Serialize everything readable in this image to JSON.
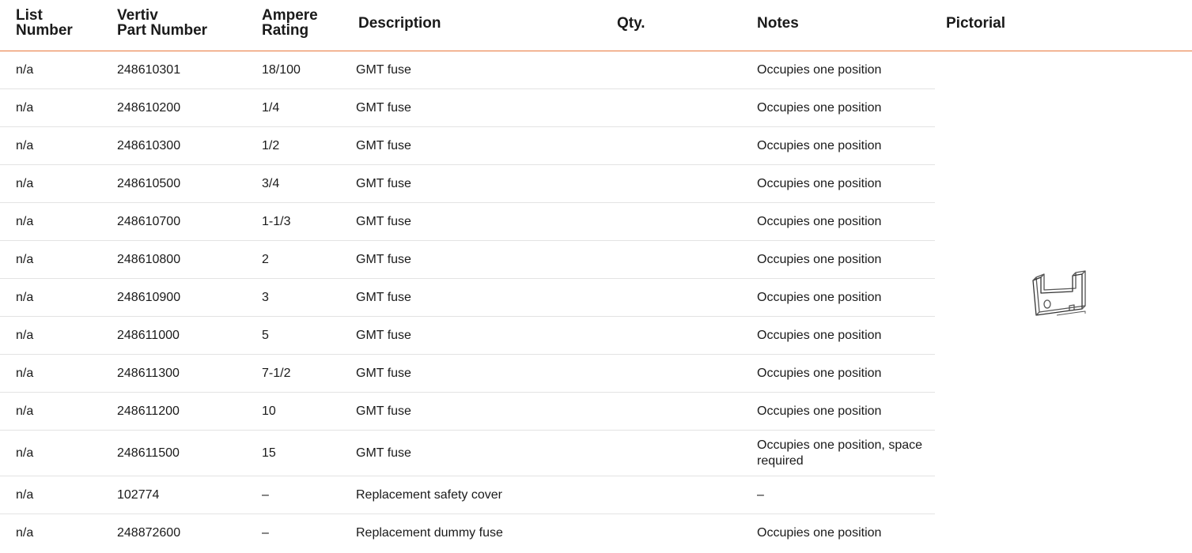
{
  "table": {
    "headers": {
      "list_number": [
        "List",
        "Number"
      ],
      "part_number": [
        "Vertiv",
        "Part Number"
      ],
      "ampere_rating": [
        "Ampere",
        "Rating"
      ],
      "description": "Description",
      "qty": "Qty.",
      "notes": "Notes",
      "pictorial": "Pictorial"
    },
    "rows": [
      {
        "list": "n/a",
        "part": "248610301",
        "amp": "18/100",
        "desc": "GMT fuse",
        "qty": "",
        "notes": "Occupies one position"
      },
      {
        "list": "n/a",
        "part": "248610200",
        "amp": "1/4",
        "desc": "GMT fuse",
        "qty": "",
        "notes": "Occupies one position"
      },
      {
        "list": "n/a",
        "part": "248610300",
        "amp": "1/2",
        "desc": "GMT fuse",
        "qty": "",
        "notes": "Occupies one position"
      },
      {
        "list": "n/a",
        "part": "248610500",
        "amp": "3/4",
        "desc": "GMT fuse",
        "qty": "",
        "notes": "Occupies one position"
      },
      {
        "list": "n/a",
        "part": "248610700",
        "amp": "1-1/3",
        "desc": "GMT fuse",
        "qty": "",
        "notes": "Occupies one position"
      },
      {
        "list": "n/a",
        "part": "248610800",
        "amp": "2",
        "desc": "GMT fuse",
        "qty": "",
        "notes": "Occupies one position"
      },
      {
        "list": "n/a",
        "part": "248610900",
        "amp": "3",
        "desc": "GMT fuse",
        "qty": "",
        "notes": "Occupies one position"
      },
      {
        "list": "n/a",
        "part": "248611000",
        "amp": "5",
        "desc": "GMT fuse",
        "qty": "",
        "notes": "Occupies one position"
      },
      {
        "list": "n/a",
        "part": "248611300",
        "amp": "7-1/2",
        "desc": "GMT fuse",
        "qty": "",
        "notes": "Occupies one position"
      },
      {
        "list": "n/a",
        "part": "248611200",
        "amp": "10",
        "desc": "GMT fuse",
        "qty": "",
        "notes": "Occupies one position"
      },
      {
        "list": "n/a",
        "part": "248611500",
        "amp": "15",
        "desc": "GMT fuse",
        "qty": "",
        "notes": "Occupies one position, space required"
      },
      {
        "list": "n/a",
        "part": "102774",
        "amp": "–",
        "desc": "Replacement safety cover",
        "qty": "",
        "notes": "–"
      },
      {
        "list": "n/a",
        "part": "248872600",
        "amp": "–",
        "desc": "Replacement dummy fuse",
        "qty": "",
        "notes": "Occupies one position"
      }
    ],
    "pictorial_icon": "fuse-clip-icon"
  },
  "colors": {
    "header_rule": "#e8763a",
    "row_divider": "#e3e3e3",
    "text": "#1a1a1a"
  }
}
